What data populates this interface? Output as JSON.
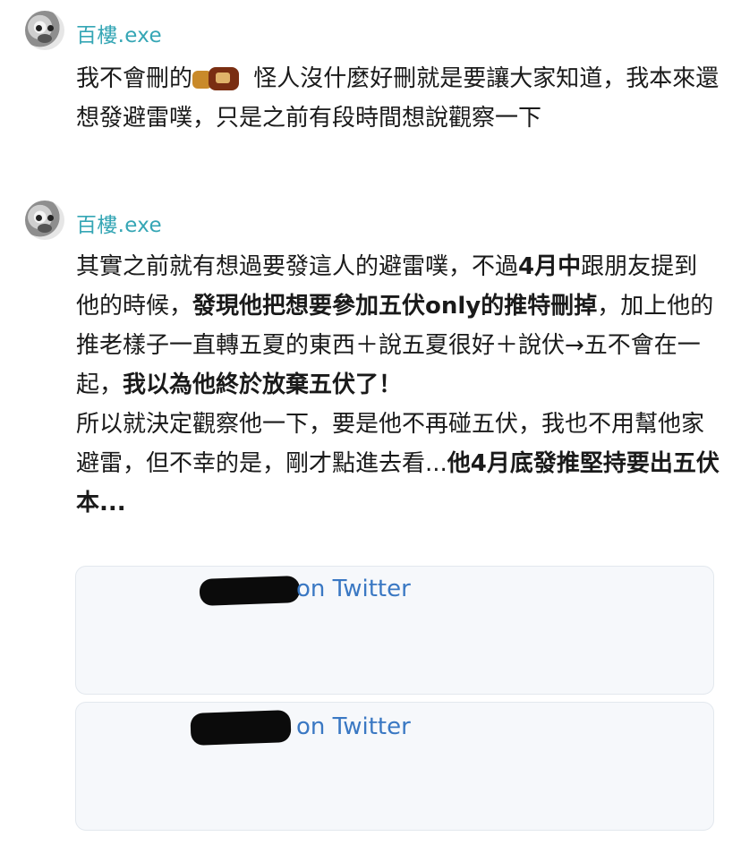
{
  "posts": [
    {
      "username": "百樓.exe",
      "text_before_emoji": "我不會刪的",
      "text_after_emoji": " 怪人沒什麼好刪就是要讓大家知道，我本來還想發避雷噗，只是之前有段時間想說觀察一下"
    },
    {
      "username": "百樓.exe",
      "segments": [
        {
          "text": "其實之前就有想過要發這人的避雷噗，不過",
          "bold": false
        },
        {
          "text": "4月中",
          "bold": true
        },
        {
          "text": "跟朋友提到他的時候，",
          "bold": false
        },
        {
          "text": "發現他把想要參加五伏only的推特刪掉",
          "bold": true
        },
        {
          "text": "，加上他的推老樣子一直轉五夏的東西＋說五夏很好＋說伏→五不會在一起，",
          "bold": false
        },
        {
          "text": "我以為他終於放棄五伏了！",
          "bold": true
        },
        {
          "text": "所以就決定觀察他一下，要是他不再碰五伏，我也不用幫他家避雷，但不幸的是，剛才點進去看...",
          "bold": false
        },
        {
          "text": "他4月底發推堅持要出五伏本...",
          "bold": true
        }
      ],
      "embeds": [
        {
          "label": "on Twitter"
        },
        {
          "label": "on Twitter"
        }
      ]
    }
  ]
}
